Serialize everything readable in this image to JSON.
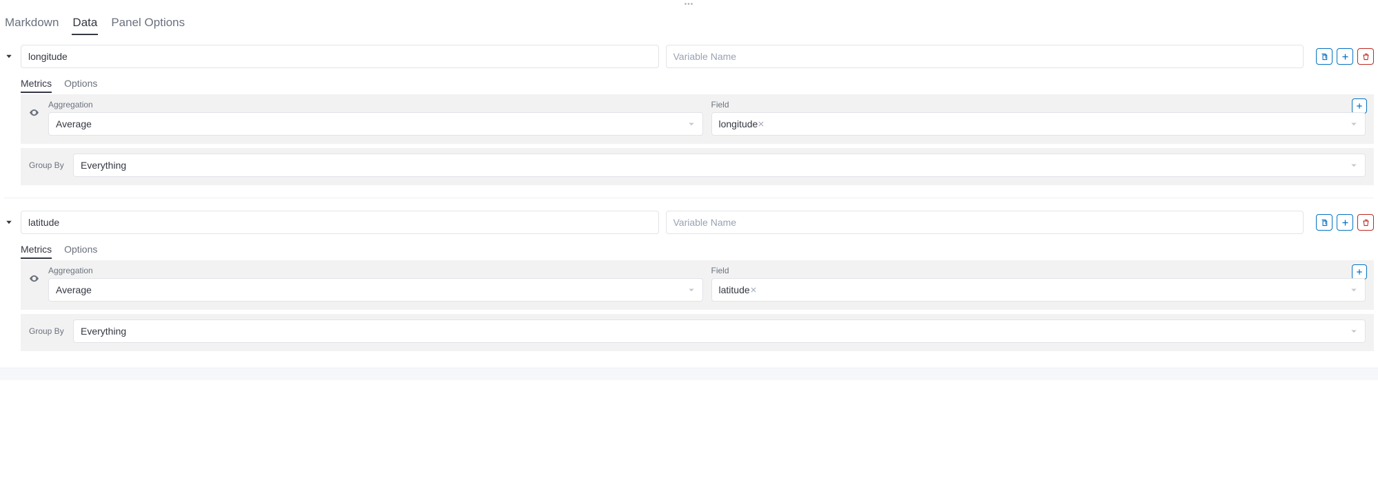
{
  "drag_handle_glyph": "•••",
  "main_tabs": {
    "markdown": "Markdown",
    "data": "Data",
    "panel_options": "Panel Options"
  },
  "variable_name_placeholder": "Variable Name",
  "sub_tabs": {
    "metrics": "Metrics",
    "options": "Options"
  },
  "labels": {
    "aggregation": "Aggregation",
    "field": "Field",
    "group_by": "Group By"
  },
  "queries": [
    {
      "name": "longitude",
      "variable_name": "",
      "aggregation": "Average",
      "field": "longitude",
      "group_by": "Everything"
    },
    {
      "name": "latitude",
      "variable_name": "",
      "aggregation": "Average",
      "field": "latitude",
      "group_by": "Everything"
    }
  ]
}
